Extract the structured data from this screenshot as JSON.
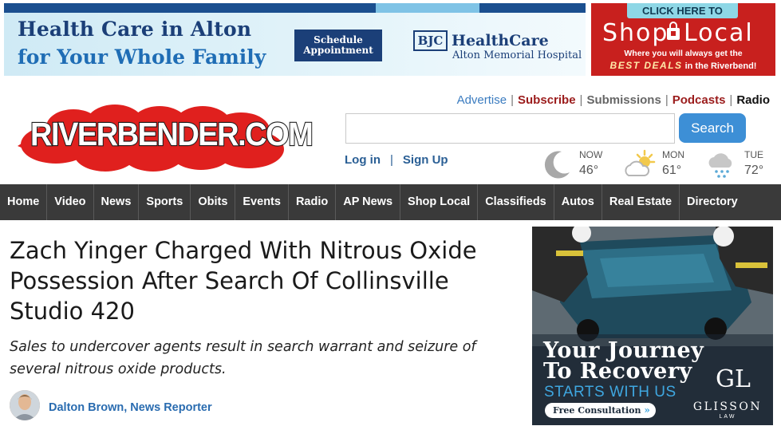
{
  "ads": {
    "top": {
      "line1": "Health Care in Alton",
      "line2": "for Your Whole Family",
      "cta": [
        "Schedule",
        "Appointment"
      ],
      "bjc": "BJC",
      "brand": "HealthCare",
      "hospital": "Alton Memorial Hospital"
    },
    "shop_local": {
      "click": "CLICK HERE TO",
      "shop": "Shop",
      "local": "Local",
      "tagline": "Where you will always get the",
      "best_prefix": "BEST DEALS",
      "best_suffix": " in the Riverbend!"
    },
    "side": {
      "line1": "Your Journey",
      "line2": "To Recovery",
      "line3": "STARTS WITH US",
      "cta": "Free Consultation",
      "cta_chevrons": "»",
      "monogram": "GL",
      "firm": "GLISSON",
      "firm_sub": "LAW"
    }
  },
  "logo": {
    "text": "RIVERBENDER.COM"
  },
  "top_links": {
    "advertise": "Advertise",
    "subscribe": "Subscribe",
    "submissions": "Submissions",
    "podcasts": "Podcasts",
    "radio": "Radio",
    "separator": "|"
  },
  "search": {
    "placeholder": "",
    "value": "",
    "button": "Search"
  },
  "auth": {
    "login": "Log in",
    "separator": "|",
    "signup": "Sign Up"
  },
  "weather": [
    {
      "day": "NOW",
      "temp": "46°",
      "icon": "moon-icon"
    },
    {
      "day": "MON",
      "temp": "61°",
      "icon": "partly-sunny-icon"
    },
    {
      "day": "TUE",
      "temp": "72°",
      "icon": "rain-cloud-icon"
    }
  ],
  "nav": [
    "Home",
    "Video",
    "News",
    "Sports",
    "Obits",
    "Events",
    "Radio",
    "AP News",
    "Shop Local",
    "Classifieds",
    "Autos",
    "Real Estate",
    "Directory"
  ],
  "article": {
    "headline": "Zach Yinger Charged With Nitrous Oxide Possession After Search Of Collinsville Studio 420",
    "subhead": "Sales to undercover agents result in search warrant and seizure of several nitrous oxide products.",
    "byline": "Dalton Brown, News Reporter"
  },
  "colors": {
    "nav_bg": "#3a3a3a",
    "accent_blue": "#3d8fd6",
    "logo_red": "#e0201e",
    "link_red": "#9b1c1c"
  }
}
